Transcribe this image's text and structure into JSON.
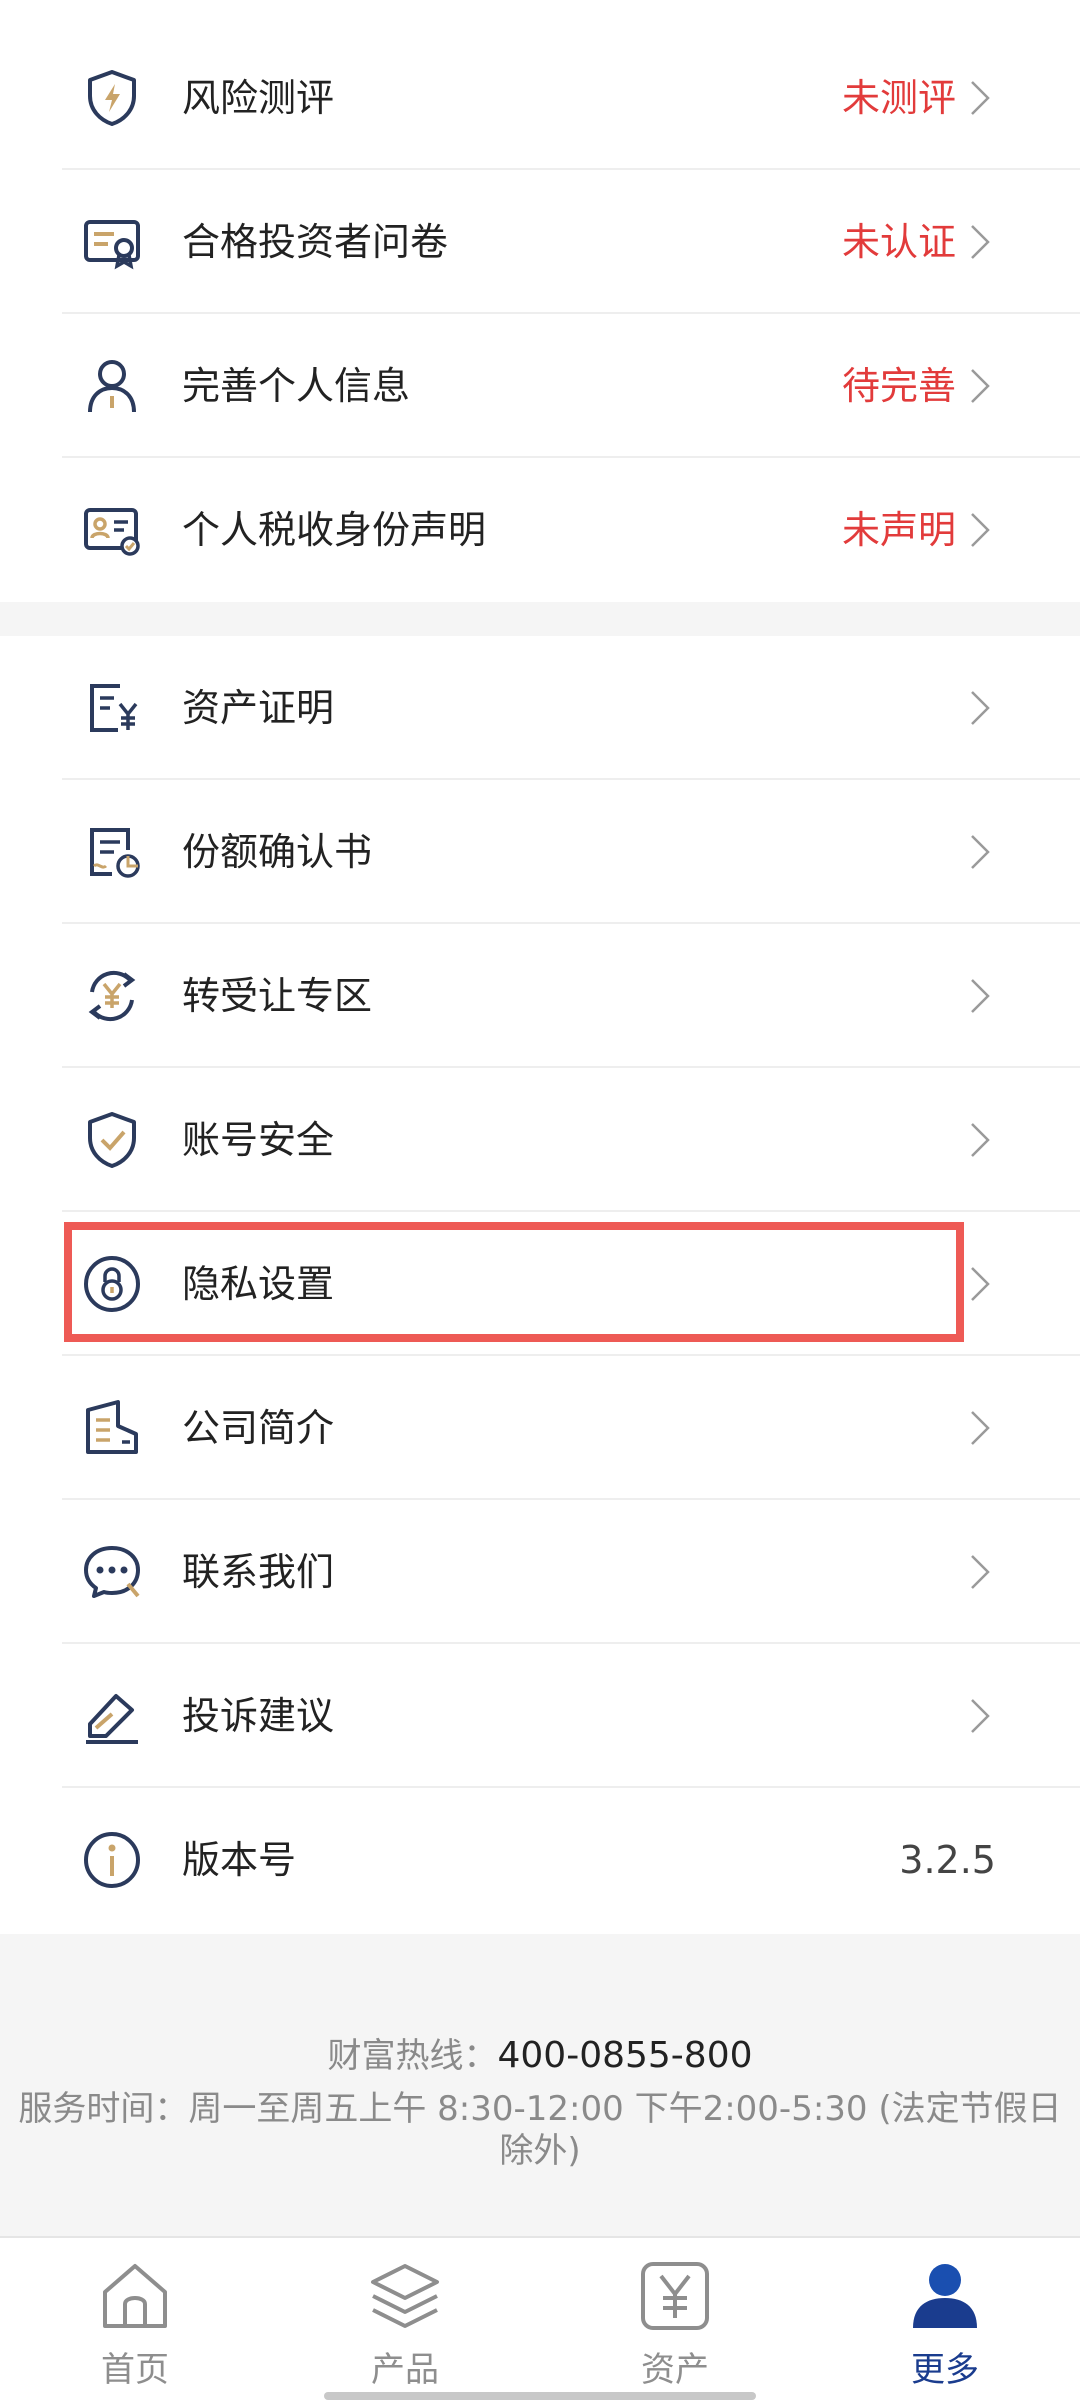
{
  "group_one": [
    {
      "label": "风险测评",
      "status": "未测评"
    },
    {
      "label": "合格投资者问卷",
      "status": "未认证"
    },
    {
      "label": "完善个人信息",
      "status": "待完善"
    },
    {
      "label": "个人税收身份声明",
      "status": "未声明"
    }
  ],
  "group_two": [
    {
      "label": "资产证明"
    },
    {
      "label": "份额确认书"
    },
    {
      "label": "转受让专区"
    },
    {
      "label": "账号安全"
    },
    {
      "label": "隐私设置"
    },
    {
      "label": "公司简介"
    },
    {
      "label": "联系我们"
    },
    {
      "label": "投诉建议"
    },
    {
      "label": "版本号",
      "value": "3.2.5"
    }
  ],
  "footer": {
    "hotline_label": "财富热线：",
    "hotline_number": "400-0855-800",
    "service_hours": "服务时间：周一至周五上午 8:30-12:00 下午2:00-5:30 (法定节假日除外)"
  },
  "tabbar": [
    {
      "label": "首页",
      "icon": "home-icon"
    },
    {
      "label": "产品",
      "icon": "layers-icon"
    },
    {
      "label": "资产",
      "icon": "yen-icon"
    },
    {
      "label": "更多",
      "icon": "user-icon",
      "active": true
    }
  ],
  "colors": {
    "status_red": "#e23b3b",
    "icon_navy": "#2b3a5c",
    "icon_gold": "#c9a46a",
    "active_blue": "#1a3c8e",
    "highlight_red": "#ee5a55"
  }
}
